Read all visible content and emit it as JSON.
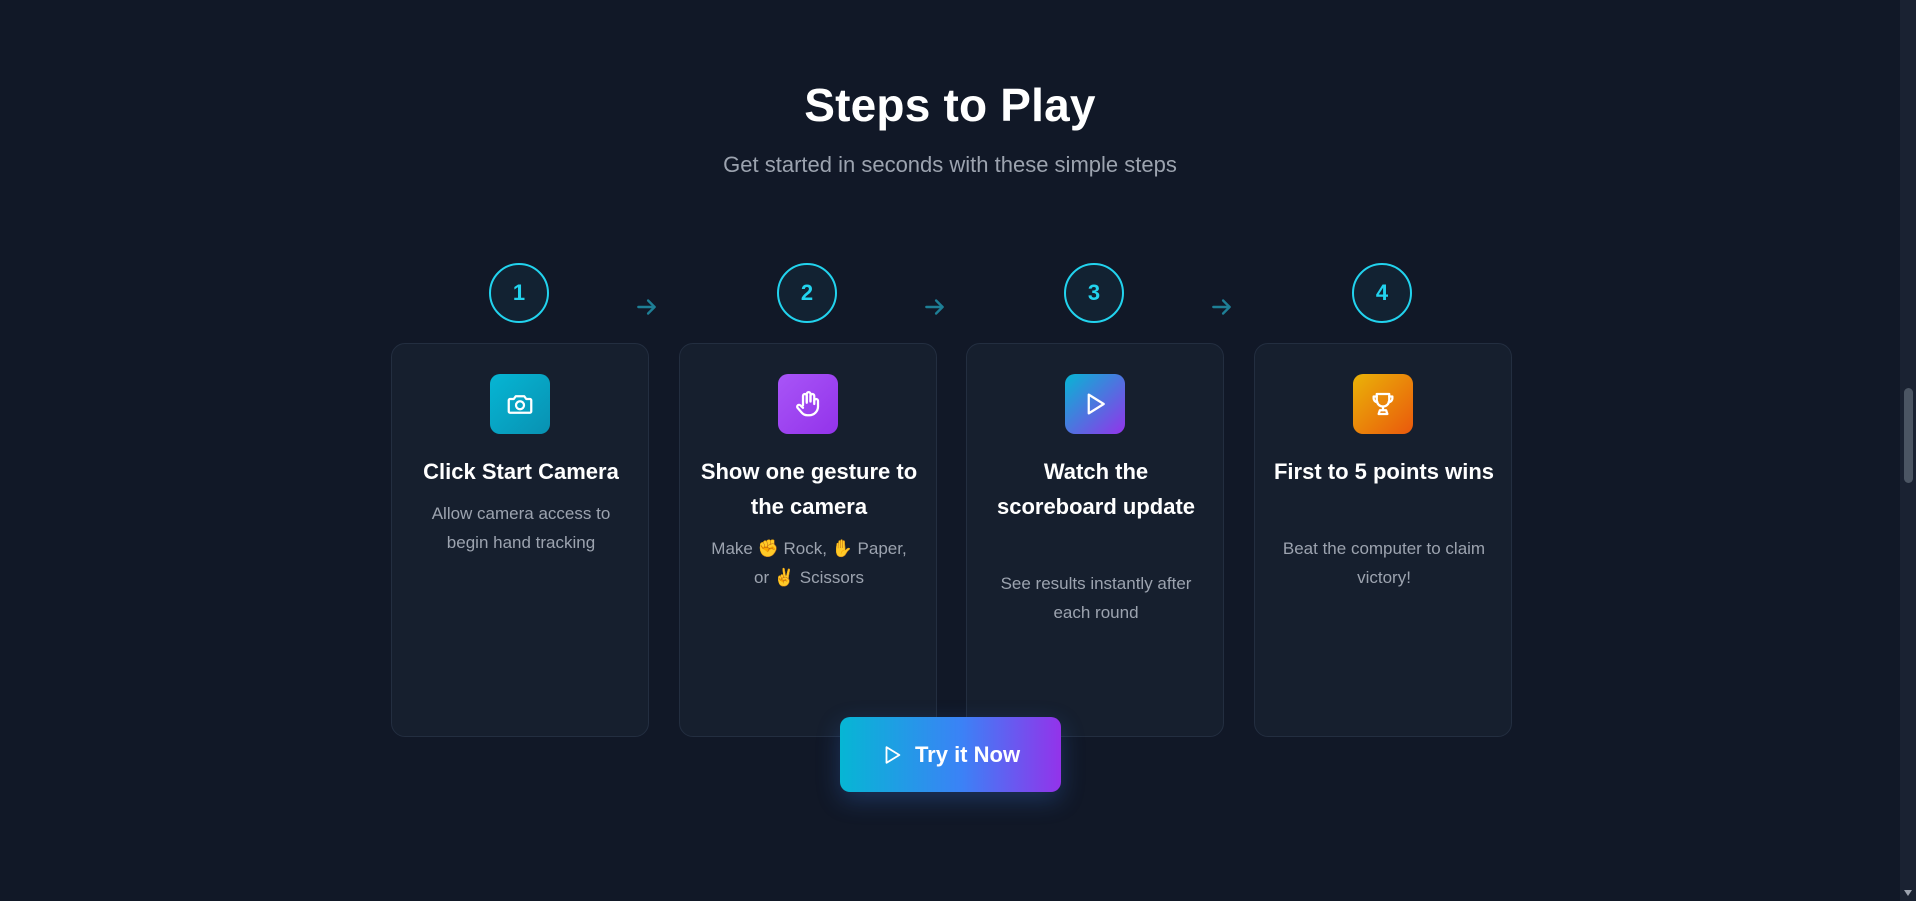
{
  "section": {
    "title": "Steps to Play",
    "subtitle": "Get started in seconds with these simple steps"
  },
  "steps": [
    {
      "number": "1",
      "icon": "camera-icon",
      "icon_color": "#06b6d4",
      "title": "Click Start Camera",
      "description": "Allow camera access to begin hand tracking"
    },
    {
      "number": "2",
      "icon": "hand-icon",
      "icon_color": "#a855f7",
      "title": "Show one gesture to the camera",
      "description": "Make ✊ Rock, ✋ Paper, or ✌️ Scissors"
    },
    {
      "number": "3",
      "icon": "play-icon",
      "icon_color": "#6366f1",
      "title": "Watch the scoreboard update",
      "description": "See results instantly after each round"
    },
    {
      "number": "4",
      "icon": "trophy-icon",
      "icon_color": "#f59e0b",
      "title": "First to 5 points wins",
      "description": "Beat the computer to claim victory!"
    }
  ],
  "cta": {
    "label": "Try it Now",
    "icon": "play-icon"
  },
  "colors": {
    "background": "#111827",
    "accent": "#22d3ee",
    "card": "#161f2e",
    "muted_text": "#9ca3af"
  }
}
